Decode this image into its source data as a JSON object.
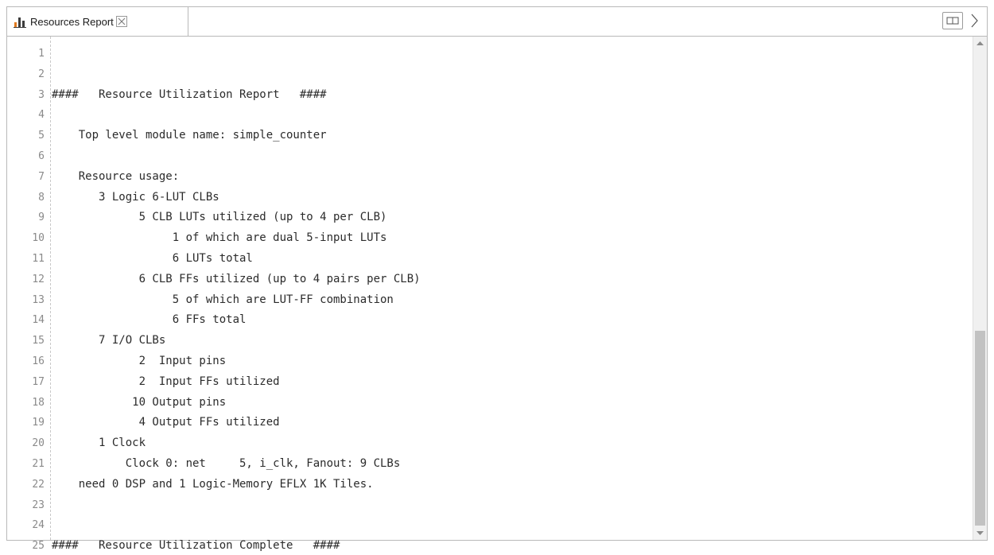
{
  "tab": {
    "icon": "bar-chart-icon",
    "label": "Resources Report"
  },
  "toolbar": {
    "split_icon": "split-view-icon",
    "next_icon": "chevron-right-icon"
  },
  "editor": {
    "lines": [
      {
        "n": "1",
        "text": ""
      },
      {
        "n": "2",
        "text": ""
      },
      {
        "n": "3",
        "text": "####   Resource Utilization Report   ####"
      },
      {
        "n": "4",
        "text": ""
      },
      {
        "n": "5",
        "text": "    Top level module name: simple_counter"
      },
      {
        "n": "6",
        "text": ""
      },
      {
        "n": "7",
        "text": "    Resource usage:"
      },
      {
        "n": "8",
        "text": "       3 Logic 6-LUT CLBs"
      },
      {
        "n": "9",
        "text": "             5 CLB LUTs utilized (up to 4 per CLB)"
      },
      {
        "n": "10",
        "text": "                  1 of which are dual 5-input LUTs"
      },
      {
        "n": "11",
        "text": "                  6 LUTs total"
      },
      {
        "n": "12",
        "text": "             6 CLB FFs utilized (up to 4 pairs per CLB)"
      },
      {
        "n": "13",
        "text": "                  5 of which are LUT-FF combination"
      },
      {
        "n": "14",
        "text": "                  6 FFs total"
      },
      {
        "n": "15",
        "text": "       7 I/O CLBs"
      },
      {
        "n": "16",
        "text": "             2  Input pins"
      },
      {
        "n": "17",
        "text": "             2  Input FFs utilized"
      },
      {
        "n": "18",
        "text": "            10 Output pins"
      },
      {
        "n": "19",
        "text": "             4 Output FFs utilized"
      },
      {
        "n": "20",
        "text": "       1 Clock"
      },
      {
        "n": "21",
        "text": "           Clock 0: net     5, i_clk, Fanout: 9 CLBs"
      },
      {
        "n": "22",
        "text": "    need 0 DSP and 1 Logic-Memory EFLX 1K Tiles."
      },
      {
        "n": "23",
        "text": ""
      },
      {
        "n": "24",
        "text": ""
      },
      {
        "n": "25",
        "text": "####   Resource Utilization Complete   ####"
      }
    ]
  }
}
